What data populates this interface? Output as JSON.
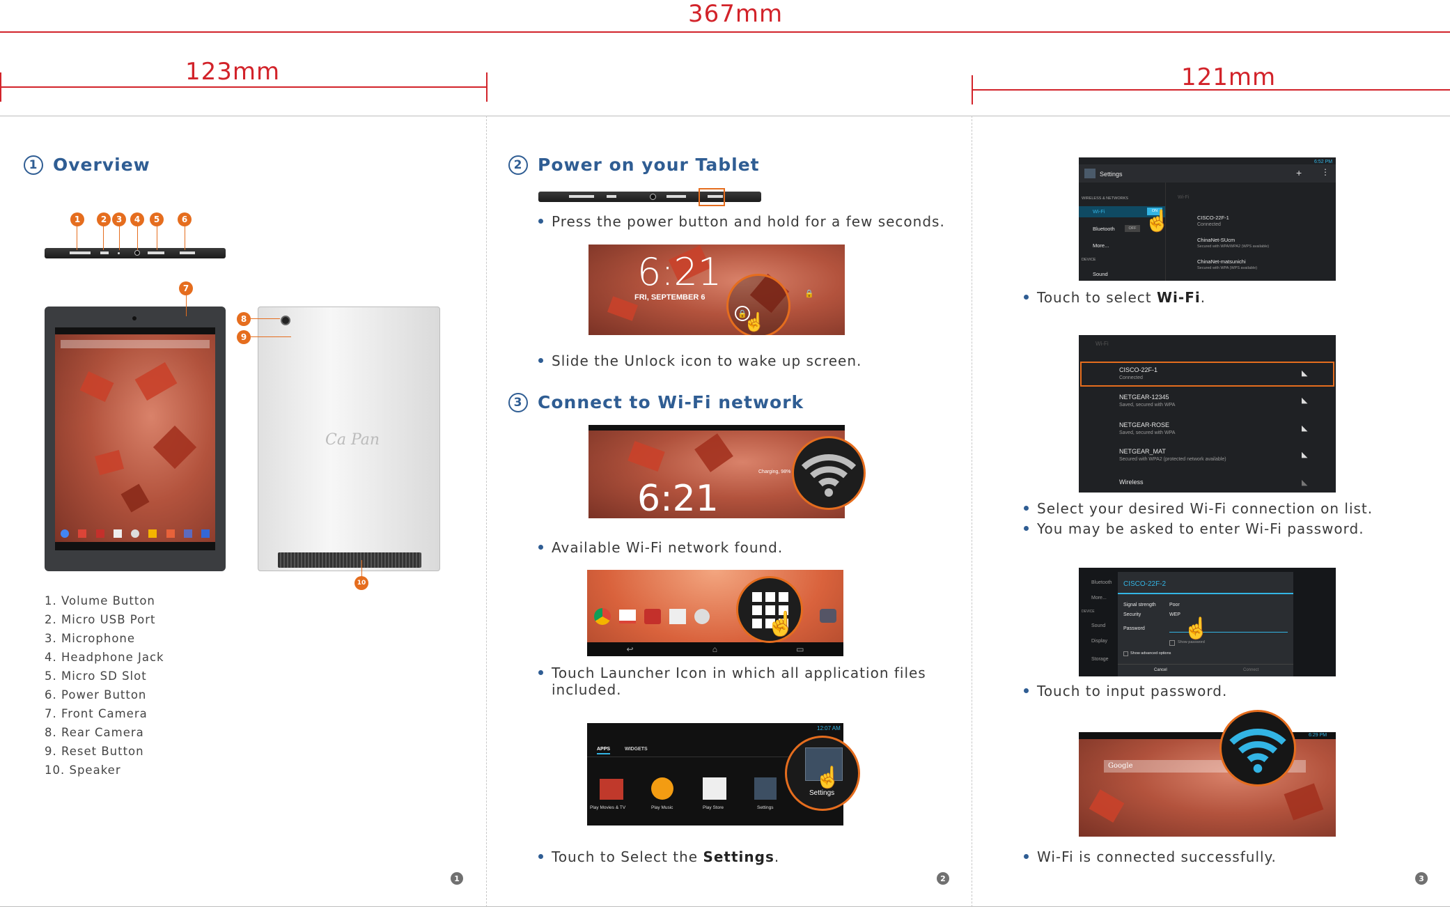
{
  "dimensions": {
    "total": "367mm",
    "left": "123mm",
    "right": "121mm"
  },
  "sections": {
    "overview": {
      "number": "①",
      "title": "Overview"
    },
    "power": {
      "number": "②",
      "title": "Power on your Tablet"
    },
    "wifi": {
      "number": "③",
      "title": "Connect to Wi-Fi network"
    }
  },
  "overview_list": [
    "1. Volume Button",
    "2. Micro USB Port",
    "3. Microphone",
    "4. Headphone Jack",
    "5. Micro SD Slot",
    "6. Power Button",
    "7. Front Camera",
    "8. Rear Camera",
    "9. Reset Button",
    "10. Speaker"
  ],
  "callouts": [
    "1",
    "2",
    "3",
    "4",
    "5",
    "6",
    "7",
    "8",
    "9",
    "10"
  ],
  "brand_logo": "Ca Pan",
  "page2": {
    "b1": "Press the power button and hold for a few seconds.",
    "b2": "Slide  the Unlock  icon to wake up screen.",
    "b3": "Available Wi-Fi network found.",
    "b4_line1": "Touch Launcher Icon in which all application files",
    "b4_line2": "included.",
    "b5_pre": "Touch  to  Select the ",
    "b5_bold": "Settings",
    "b5_post": "."
  },
  "page3": {
    "b1_pre": "Touch to select ",
    "b1_bold": "Wi-Fi",
    "b1_post": ".",
    "b2": "Select your desired Wi-Fi connection on list.",
    "b3": "You may be asked to enter Wi-Fi password.",
    "b4": "Touch to input password.",
    "b5": "Wi-Fi is connected successfully."
  },
  "lockscreen": {
    "time": "6:21",
    "date": "FRI, SEPTEMBER 6"
  },
  "homescreen": {
    "time": "6:21",
    "charging": "Charging, 98%"
  },
  "launcher_tabs": [
    "APPS",
    "WIDGETS"
  ],
  "launcher_status_time": "12:07 AM",
  "launcher_apps": [
    "Play Movies & TV",
    "Play Music",
    "Play Store",
    "Settings"
  ],
  "settings_callout": "Settings",
  "settings_screen": {
    "title": "Settings",
    "status_time": "6:52 PM",
    "section_wireless": "WIRELESS & NETWORKS",
    "wifi": "Wi-Fi",
    "wifi_toggle": "ON",
    "bluetooth": "Bluetooth",
    "bluetooth_toggle": "OFF",
    "more": "More...",
    "section_device": "DEVICE",
    "sound": "Sound",
    "right_header": "Wi-Fi",
    "networks": [
      {
        "name": "CISCO-22F-1",
        "status": "Connected"
      },
      {
        "name": "ChinaNet-SUcm",
        "status": "Secured with WPA/WPA2 (WPS available)"
      },
      {
        "name": "ChinaNet-matsunichi",
        "status": "Secured with WPA (WPS available)"
      }
    ]
  },
  "wifi_list": {
    "header": "Wi-Fi",
    "networks": [
      {
        "name": "CISCO-22F-1",
        "status": "Connected"
      },
      {
        "name": "NETGEAR-12345",
        "status": "Saved, secured with WPA"
      },
      {
        "name": "NETGEAR-ROSE",
        "status": "Saved, secured with WPA"
      },
      {
        "name": "NETGEAR_MAT",
        "status": "Secured with WPA2 (protected network available)"
      },
      {
        "name": "Wireless",
        "status": ""
      }
    ]
  },
  "password_dialog": {
    "title": "CISCO-22F-2",
    "signal_label": "Signal strength",
    "signal_value": "Poor",
    "security_label": "Security",
    "security_value": "WEP",
    "password_label": "Password",
    "show_password": "Show password",
    "advanced": "Show advanced options",
    "cancel": "Cancel",
    "connect": "Connect",
    "side_items": [
      "Bluetooth",
      "More...",
      "DEVICE",
      "Sound",
      "Display",
      "Storage"
    ]
  },
  "connected_screen": {
    "search": "Google",
    "status_time": "6:29 PM"
  },
  "page_numbers": [
    "1",
    "2",
    "3"
  ],
  "colors": {
    "dimension_red": "#d2232a",
    "title_blue": "#2f5d93",
    "callout_orange": "#e56d1e",
    "wifi_blue": "#33b5e5"
  }
}
